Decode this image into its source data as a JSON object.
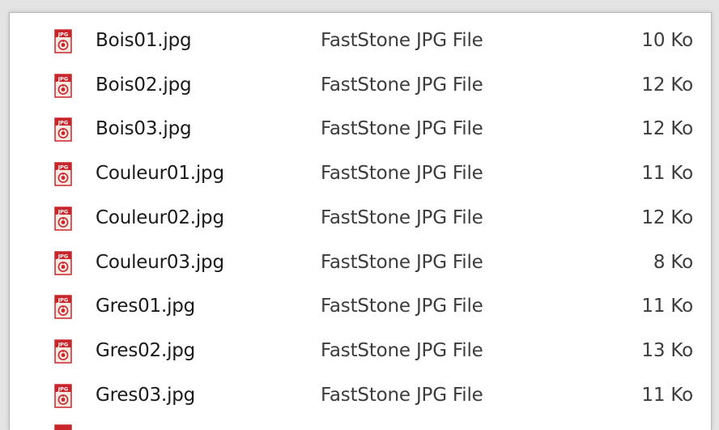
{
  "files": [
    {
      "name": "Bois01.jpg",
      "type": "FastStone JPG File",
      "size": "10 Ko",
      "icon": "faststone-jpg-icon"
    },
    {
      "name": "Bois02.jpg",
      "type": "FastStone JPG File",
      "size": "12 Ko",
      "icon": "faststone-jpg-icon"
    },
    {
      "name": "Bois03.jpg",
      "type": "FastStone JPG File",
      "size": "12 Ko",
      "icon": "faststone-jpg-icon"
    },
    {
      "name": "Couleur01.jpg",
      "type": "FastStone JPG File",
      "size": "11 Ko",
      "icon": "faststone-jpg-icon"
    },
    {
      "name": "Couleur02.jpg",
      "type": "FastStone JPG File",
      "size": "12 Ko",
      "icon": "faststone-jpg-icon"
    },
    {
      "name": "Couleur03.jpg",
      "type": "FastStone JPG File",
      "size": "8 Ko",
      "icon": "faststone-jpg-icon"
    },
    {
      "name": "Gres01.jpg",
      "type": "FastStone JPG File",
      "size": "11 Ko",
      "icon": "faststone-jpg-icon"
    },
    {
      "name": "Gres02.jpg",
      "type": "FastStone JPG File",
      "size": "13 Ko",
      "icon": "faststone-jpg-icon"
    },
    {
      "name": "Gres03.jpg",
      "type": "FastStone JPG File",
      "size": "11 Ko",
      "icon": "faststone-jpg-icon"
    }
  ],
  "colors": {
    "icon_red": "#c8262b",
    "icon_paper": "#fbe9e4",
    "pane_background": "#ffffff",
    "window_background": "#e4e4e4"
  }
}
